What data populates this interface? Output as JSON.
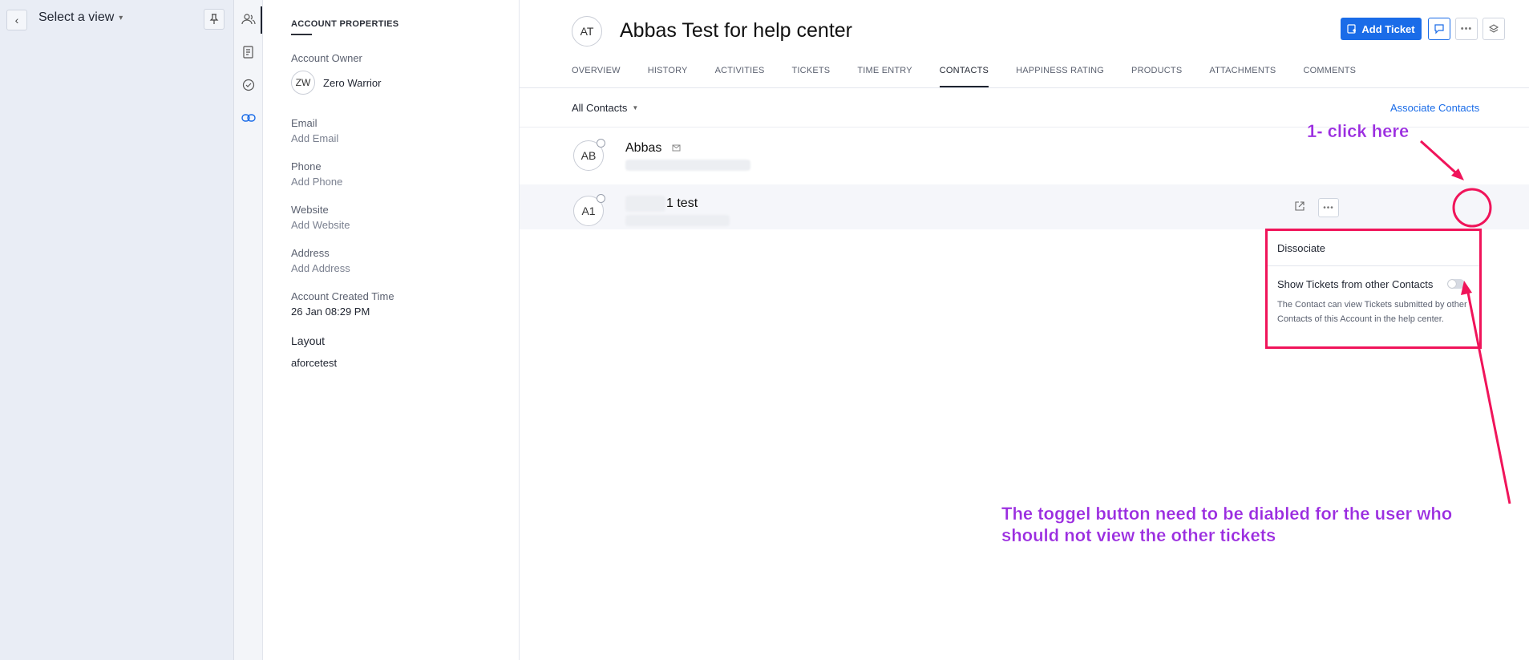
{
  "view_panel": {
    "title": "Select a view",
    "back_icon": "chevron-left-icon",
    "pin_icon": "pin-icon"
  },
  "icon_rail": {
    "items": [
      "contacts-icon",
      "notes-icon",
      "check-circle-icon",
      "link-icon"
    ]
  },
  "account_properties": {
    "title": "ACCOUNT PROPERTIES",
    "owner_label": "Account Owner",
    "owner_initials": "ZW",
    "owner_name": "Zero Warrior",
    "email_label": "Email",
    "email_value": "Add Email",
    "phone_label": "Phone",
    "phone_value": "Add Phone",
    "website_label": "Website",
    "website_value": "Add Website",
    "address_label": "Address",
    "address_value": "Add Address",
    "created_label": "Account Created Time",
    "created_value": "26 Jan 08:29 PM",
    "layout_label": "Layout",
    "layout_value": "aforcetest"
  },
  "header": {
    "initials": "AT",
    "title": "Abbas Test for help center",
    "add_ticket_label": "Add Ticket"
  },
  "tabs": [
    "OVERVIEW",
    "HISTORY",
    "ACTIVITIES",
    "TICKETS",
    "TIME ENTRY",
    "CONTACTS",
    "HAPPINESS RATING",
    "PRODUCTS",
    "ATTACHMENTS",
    "COMMENTS"
  ],
  "active_tab": "CONTACTS",
  "contacts": {
    "filter_label": "All Contacts",
    "associate_label": "Associate Contacts",
    "rows": [
      {
        "initials": "AB",
        "name": "Abbas"
      },
      {
        "initials": "A1",
        "name": "1 test"
      }
    ]
  },
  "dropdown": {
    "dissociate_label": "Dissociate",
    "toggle_label": "Show Tickets from other Contacts",
    "toggle_on": false,
    "description": "The Contact can view Tickets submitted by other Contacts of this Account in the help center."
  },
  "annotations": {
    "step1": "1- click here",
    "note_line1": "The toggel button need to be diabled for the user who",
    "note_line2": "should not view the other tickets",
    "color": "#f0145a",
    "text_color": "#9b2de0"
  },
  "colors": {
    "accent": "#1a6ce8",
    "panel_bg": "#e9edf5"
  }
}
